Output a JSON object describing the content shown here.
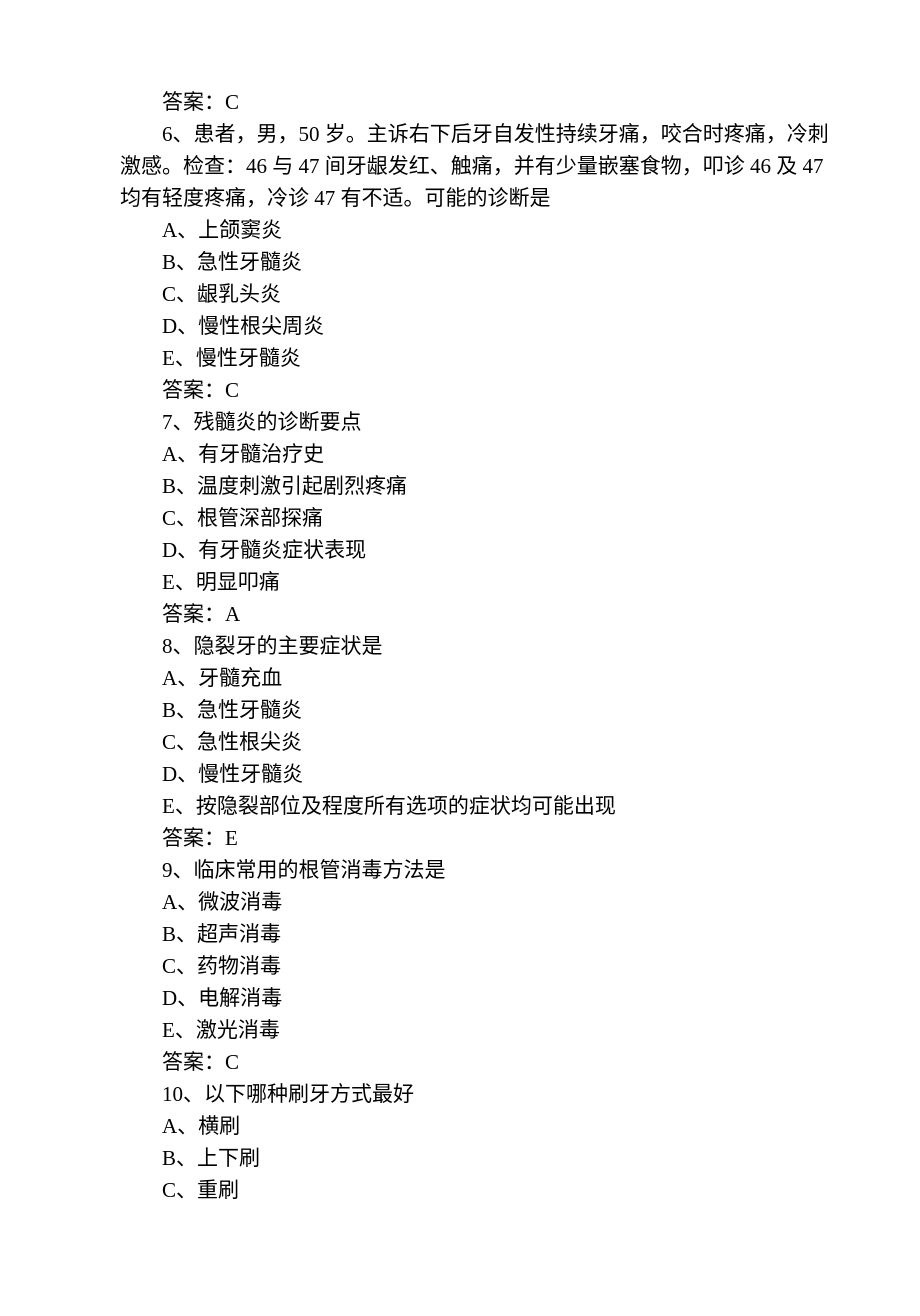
{
  "q5": {
    "answer_prefix": "答案：",
    "answer": "C"
  },
  "q6": {
    "stem_l1": "6、患者，男，50 岁。主诉右下后牙自发性持续牙痛，咬合时疼痛，冷刺",
    "stem_l2": "激感。检查：46 与 47 间牙龈发红、触痛，并有少量嵌塞食物，叩诊 46 及 47",
    "stem_l3": "均有轻度疼痛，冷诊 47 有不适。可能的诊断是",
    "A": "A、上颌窦炎",
    "B": "B、急性牙髓炎",
    "C": "C、龈乳头炎",
    "D": "D、慢性根尖周炎",
    "E": "E、慢性牙髓炎",
    "answer_prefix": "答案：",
    "answer": "C"
  },
  "q7": {
    "stem": "7、残髓炎的诊断要点",
    "A": "A、有牙髓治疗史",
    "B": "B、温度刺激引起剧烈疼痛",
    "C": "C、根管深部探痛",
    "D": "D、有牙髓炎症状表现",
    "E": "E、明显叩痛",
    "answer_prefix": "答案：",
    "answer": "A"
  },
  "q8": {
    "stem": "8、隐裂牙的主要症状是",
    "A": "A、牙髓充血",
    "B": "B、急性牙髓炎",
    "C": "C、急性根尖炎",
    "D": "D、慢性牙髓炎",
    "E": "E、按隐裂部位及程度所有选项的症状均可能出现",
    "answer_prefix": "答案：",
    "answer": "E"
  },
  "q9": {
    "stem": "9、临床常用的根管消毒方法是",
    "A": "A、微波消毒",
    "B": "B、超声消毒",
    "C": "C、药物消毒",
    "D": "D、电解消毒",
    "E": "E、激光消毒",
    "answer_prefix": "答案：",
    "answer": "C"
  },
  "q10": {
    "stem": "10、以下哪种刷牙方式最好",
    "A": "A、横刷",
    "B": "B、上下刷",
    "C": "C、重刷"
  }
}
